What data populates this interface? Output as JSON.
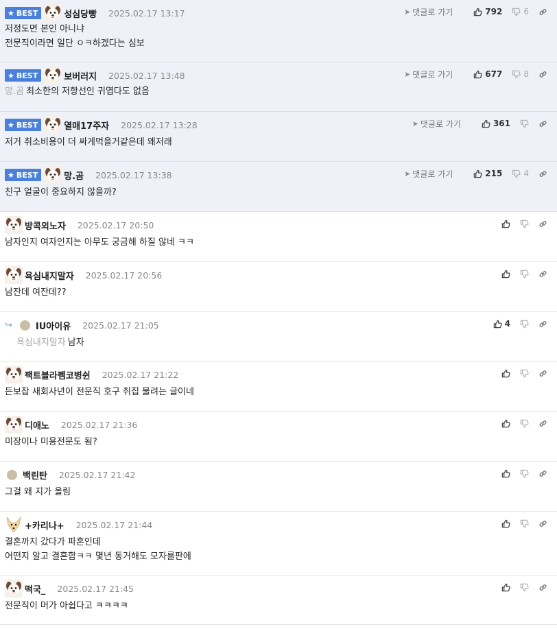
{
  "labels": {
    "best": "BEST",
    "goto": "댓글로 가기"
  },
  "colors": {
    "best_bg": "#eef2f8",
    "badge": "#4a80dc",
    "date": "#888888",
    "mention": "#a8a8a8"
  },
  "comments": [
    {
      "id": "c1",
      "best": true,
      "avatar": "dog-avatar",
      "nick": "성심당빵",
      "date": "2025.02.17 13:17",
      "mention": "",
      "text": "저정도면 본인 아니냐\n전문직이라면 일단 ㅇㅋ하겠다는 심보",
      "up": "792",
      "down": "6",
      "reply": false
    },
    {
      "id": "c2",
      "best": true,
      "avatar": "dog-avatar",
      "nick": "보버러지",
      "date": "2025.02.17 13:48",
      "mention": "망.곰",
      "text": "최소한의 저항선인 귀엽다도 없음",
      "up": "677",
      "down": "8",
      "reply": false
    },
    {
      "id": "c3",
      "best": true,
      "avatar": "dog-avatar",
      "nick": "열매17주자",
      "date": "2025.02.17 13:28",
      "mention": "",
      "text": "저거 취소비용이 더 싸게먹을거같은데 왜저래",
      "up": "361",
      "down": "",
      "reply": false
    },
    {
      "id": "c4",
      "best": true,
      "avatar": "dog-avatar",
      "nick": "망.곰",
      "date": "2025.02.17 13:38",
      "mention": "",
      "text": "친구 얼굴이 중요하지 않을까?",
      "up": "215",
      "down": "4",
      "reply": false
    },
    {
      "id": "c5",
      "best": false,
      "avatar": "dog-avatar",
      "nick": "방콕외노자",
      "date": "2025.02.17 20:50",
      "mention": "",
      "text": "남자인지 여자인지는 아무도 궁금해 하질 않네 ㅋㅋ",
      "up": "",
      "down": "",
      "reply": false
    },
    {
      "id": "c6",
      "best": false,
      "avatar": "dog-avatar",
      "nick": "욕심내지말자",
      "date": "2025.02.17 20:56",
      "mention": "",
      "text": "남잔데 여잔데??",
      "up": "",
      "down": "",
      "reply": false
    },
    {
      "id": "c7",
      "best": false,
      "avatar": "dot-avatar",
      "nick": "IU아이유",
      "date": "2025.02.17 21:05",
      "mention": "욕심내지말자",
      "text": "남자",
      "up": "4",
      "down": "",
      "reply": true
    },
    {
      "id": "c8",
      "best": false,
      "avatar": "dog-avatar",
      "nick": "팩트블라펨코병쉰",
      "date": "2025.02.17 21:22",
      "mention": "",
      "text": "든보잡 새회사년이 전문직 호구 취집 물려는 글이네",
      "up": "",
      "down": "",
      "reply": false
    },
    {
      "id": "c9",
      "best": false,
      "avatar": "dog-avatar",
      "nick": "디애노",
      "date": "2025.02.17 21:36",
      "mention": "",
      "text": "미장이나 미용전문도 됨?",
      "up": "",
      "down": "",
      "reply": false
    },
    {
      "id": "c10",
      "best": false,
      "avatar": "dot-avatar",
      "nick": "백린탄",
      "date": "2025.02.17 21:42",
      "mention": "",
      "text": "그걸 왜 지가 올림",
      "up": "",
      "down": "",
      "reply": false
    },
    {
      "id": "c11",
      "best": false,
      "avatar": "fox-avatar",
      "nick": "+카리나+",
      "date": "2025.02.17 21:44",
      "mention": "",
      "text": "결혼까지 갔다가 파혼인데\n어떤지 알고 결혼함ㅋㅋ 몇년 동거해도 모자를판에",
      "up": "",
      "down": "",
      "reply": false
    },
    {
      "id": "c12",
      "best": false,
      "avatar": "dog-avatar",
      "nick": "떡국_",
      "date": "2025.02.17 21:45",
      "mention": "",
      "text": "전문직이 머가 아쉽다고 ㅋㅋㅋㅋ",
      "up": "",
      "down": "",
      "reply": false
    }
  ]
}
